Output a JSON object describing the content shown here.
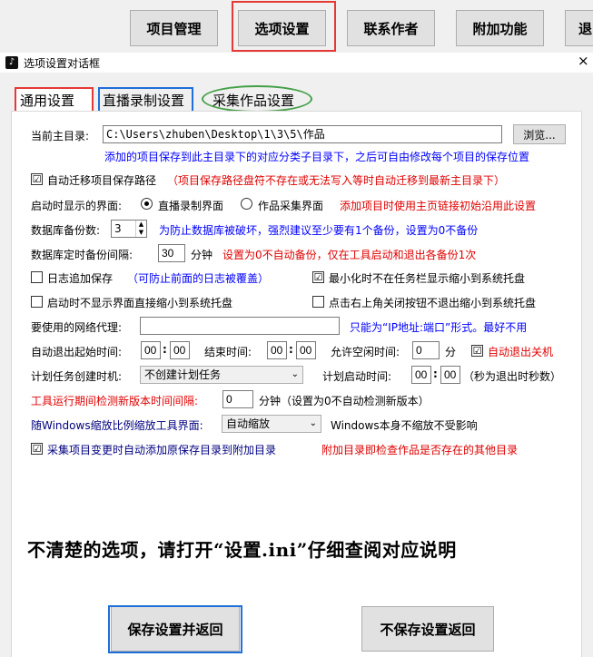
{
  "topbar": {
    "buttons": [
      {
        "label": "项目管理"
      },
      {
        "label": "选项设置"
      },
      {
        "label": "联系作者"
      },
      {
        "label": "附加功能"
      },
      {
        "label": "退"
      }
    ]
  },
  "window": {
    "title": "选项设置对话框",
    "close": "×"
  },
  "tabs": [
    {
      "label": "通用设置"
    },
    {
      "label": "直播录制设置"
    },
    {
      "label": "采集作品设置"
    }
  ],
  "form": {
    "main_dir_label": "当前主目录:",
    "main_dir_value": "C:\\Users\\zhuben\\Desktop\\1\\3\\5\\作品",
    "browse_label": "浏览...",
    "main_dir_hint": "添加的项目保存到此主目录下的对应分类子目录下，之后可自由修改每个项目的保存位置",
    "auto_migrate_label": "自动迁移项目保存路径",
    "auto_migrate_checked": "☑",
    "auto_migrate_hint": "（项目保存路径盘符不存在或无法写入等时自动迁移到最新主目录下）",
    "startup_view_label": "启动时显示的界面:",
    "startup_opt1": "直播录制界面",
    "startup_opt2": "作品采集界面",
    "startup_hint": "添加项目时使用主页链接初始沿用此设置",
    "db_backup_label": "数据库备份数:",
    "db_backup_value": "3",
    "db_backup_hint": "为防止数据库被破坏，强烈建议至少要有1个备份，设置为0不备份",
    "db_interval_label": "数据库定时备份间隔:",
    "db_interval_value": "30",
    "db_interval_unit": "分钟",
    "db_interval_hint": "设置为0不自动备份，仅在工具启动和退出各备份1次",
    "log_append_label": "日志追加保存",
    "log_append_hint": "（可防止前面的日志被覆盖）",
    "minimize_tray_label": "最小化时不在任务栏显示缩小到系统托盘",
    "minimize_tray_checked": "☑",
    "startup_tray_label": "启动时不显示界面直接缩小到系统托盘",
    "close_tray_label": "点击右上角关闭按钮不退出缩小到系统托盘",
    "proxy_label": "要使用的网络代理:",
    "proxy_value": "",
    "proxy_hint": "只能为“IP地址:端口”形式。最好不用",
    "auto_exit_start_label": "自动退出起始时间:",
    "auto_exit_start_h": "00",
    "auto_exit_start_m": "00",
    "end_time_label": "结束时间:",
    "end_h": "00",
    "end_m": "00",
    "idle_label": "允许空闲时间:",
    "idle_value": "0",
    "idle_unit": "分",
    "auto_shutdown_label": "自动退出关机",
    "auto_shutdown_checked": "☑",
    "task_label": "计划任务创建时机:",
    "task_value": "不创建计划任务",
    "task_start_label": "计划启动时间:",
    "task_start_h": "00",
    "task_start_m": "00",
    "task_start_hint": "（秒为退出时秒数）",
    "update_check_label": "工具运行期间检测新版本时间间隔:",
    "update_check_value": "0",
    "update_check_hint": "分钟（设置为0不自动检测新版本）",
    "scale_label": "随Windows缩放比例缩放工具界面:",
    "scale_value": "自动缩放",
    "scale_hint": "Windows本身不缩放不受影响",
    "attach_label": "采集项目变更时自动添加原保存目录到附加目录",
    "attach_checked": "☑",
    "attach_hint": "附加目录即检查作品是否存在的其他目录",
    "colon": ":"
  },
  "notice": "不清楚的选项，请打开“设置.ini”仔细查阅对应说明",
  "footer": {
    "save_label": "保存设置并返回",
    "nosave_label": "不保存设置返回"
  },
  "colors": {
    "annotation_red": "#e53935",
    "annotation_blue": "#1e6fd9",
    "annotation_green": "#43a047"
  }
}
